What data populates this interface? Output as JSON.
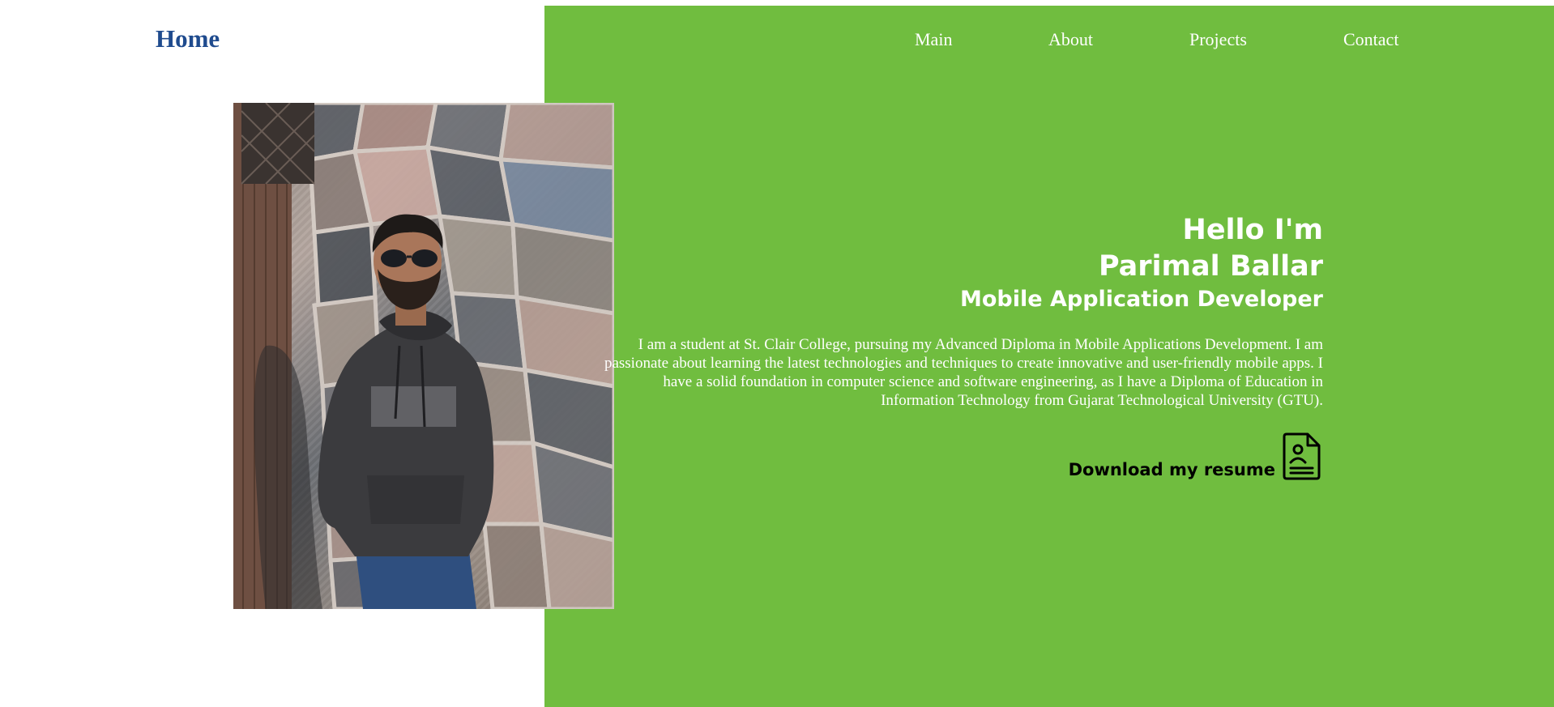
{
  "colors": {
    "panel_green": "#70bd3f",
    "brand_blue": "#1f4b8e",
    "text_on_green": "#ffffff",
    "resume_text": "#000000"
  },
  "brand": {
    "label": "Home"
  },
  "nav": {
    "items": [
      {
        "label": "Main"
      },
      {
        "label": "About"
      },
      {
        "label": "Projects"
      },
      {
        "label": "Contact"
      }
    ]
  },
  "profile_photo": {
    "icon": "person-portrait-photo"
  },
  "hero": {
    "greeting": "Hello I'm",
    "name": "Parimal Ballar",
    "title": "Mobile Application Developer",
    "bio": "I am a student at St. Clair College, pursuing my Advanced Diploma in Mobile Applications Development. I am passionate about learning the latest technologies and techniques to create innovative and user-friendly mobile apps. I have a solid foundation in computer science and software engineering, as I have a Diploma of Education in Information Technology from Gujarat Technological University (GTU)."
  },
  "resume": {
    "label": "Download my resume",
    "icon": "resume-document-icon"
  }
}
